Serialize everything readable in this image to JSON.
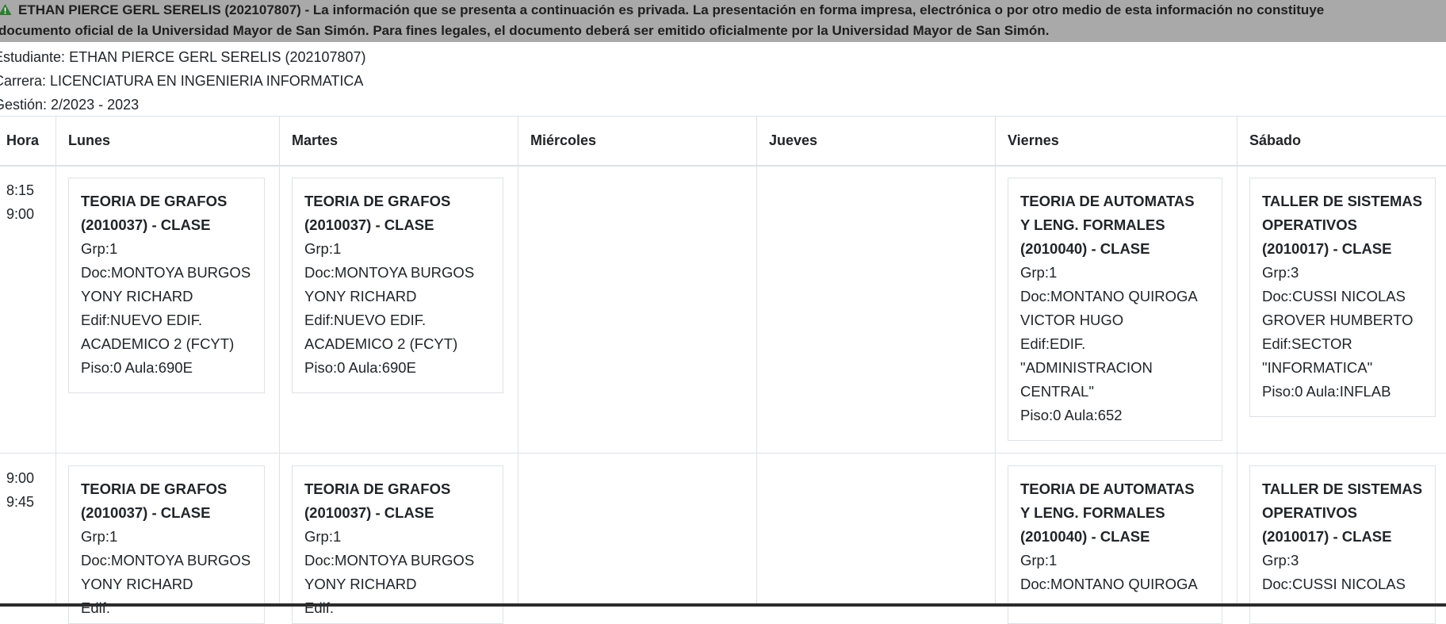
{
  "notice": {
    "line1": "ETHAN PIERCE GERL SERELIS (202107807) - La información que se presenta a continuación es privada. La presentación en forma impresa, electrónica o por otro medio de esta información no constituye",
    "line2": "documento oficial de la Universidad Mayor de San Simón. Para fines legales, el documento deberá ser emitido oficialmente por la Universidad Mayor de San Simón.",
    "icon": "warning-triangle-icon",
    "icon_color": "#2e7d32"
  },
  "student": {
    "name": "Estudiante: ETHAN PIERCE GERL SERELIS (202107807)",
    "career": "Carrera: LICENCIATURA EN INGENIERIA INFORMATICA",
    "term": "Gestión: 2/2023 - 2023"
  },
  "schedule": {
    "headers": [
      "Hora",
      "Lunes",
      "Martes",
      "Miércoles",
      "Jueves",
      "Viernes",
      "Sábado"
    ],
    "rows": [
      {
        "start": "8:15",
        "end": "9:00",
        "cells": [
          {
            "title1": "TEORIA DE GRAFOS",
            "title2": "(2010037) - CLASE",
            "lines": [
              "Grp:1",
              "Doc:MONTOYA BURGOS",
              "YONY RICHARD",
              "Edif:NUEVO EDIF.",
              "ACADEMICO 2 (FCYT)",
              "Piso:0 Aula:690E"
            ]
          },
          {
            "title1": "TEORIA DE GRAFOS",
            "title2": "(2010037) - CLASE",
            "lines": [
              "Grp:1",
              "Doc:MONTOYA BURGOS",
              "YONY RICHARD",
              "Edif:NUEVO EDIF.",
              "ACADEMICO 2 (FCYT)",
              "Piso:0 Aula:690E"
            ]
          },
          {
            "title1": "TEORIA DE AUTOMATAS",
            "title2": "Y LENG. FORMALES",
            "title3": "(2010040) - CLASE",
            "lines": [
              "Grp:1",
              "Doc:MONTANO QUIROGA",
              "VICTOR HUGO",
              "Edif:EDIF.",
              "\"ADMINISTRACION",
              "CENTRAL\"",
              "Piso:0 Aula:652"
            ]
          },
          {
            "title1": "TALLER DE SISTEMAS",
            "title2": "OPERATIVOS",
            "title3": "(2010017) - CLASE",
            "lines": [
              "Grp:3",
              "Doc:CUSSI NICOLAS",
              "GROVER HUMBERTO",
              "Edif:SECTOR",
              "\"INFORMATICA\"",
              "Piso:0 Aula:INFLAB"
            ]
          }
        ]
      },
      {
        "start": "9:00",
        "end": "9:45",
        "cells": [
          {
            "title1": "TEORIA DE GRAFOS",
            "title2": "(2010037) - CLASE",
            "lines": [
              "Grp:1",
              "Doc:MONTOYA BURGOS",
              "YONY RICHARD",
              "Edif:"
            ]
          },
          {
            "title1": "TEORIA DE GRAFOS",
            "title2": "(2010037) - CLASE",
            "lines": [
              "Grp:1",
              "Doc:MONTOYA BURGOS",
              "YONY RICHARD",
              "Edif:"
            ]
          },
          {
            "title1": "TEORIA DE AUTOMATAS",
            "title2": "Y LENG. FORMALES",
            "title3": "(2010040) - CLASE",
            "lines": [
              "Grp:1",
              "Doc:MONTANO QUIROGA"
            ]
          },
          {
            "title1": "TALLER DE SISTEMAS",
            "title2": "OPERATIVOS",
            "title3": "(2010017) - CLASE",
            "lines": [
              "Grp:3",
              "Doc:CUSSI NICOLAS"
            ]
          }
        ]
      }
    ]
  }
}
